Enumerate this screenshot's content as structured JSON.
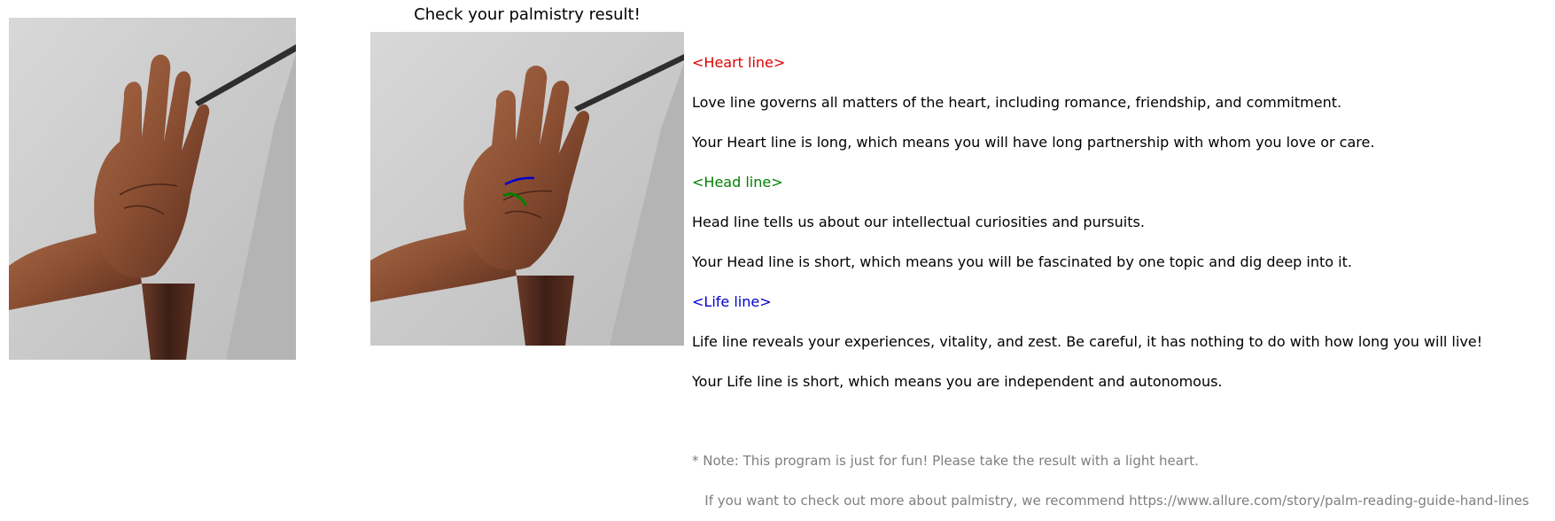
{
  "title": "Check your palmistry result!",
  "colors": {
    "heart": "#e00000",
    "head": "#008000",
    "life": "#0000d0",
    "note": "#7f7f7f",
    "text": "#000000"
  },
  "images": {
    "left": "original-hand-photo",
    "right": "annotated-hand-photo"
  },
  "sections": [
    {
      "heading": "<Heart line>",
      "lines": [
        "Love line governs all matters of the heart, including romance, friendship, and commitment.",
        "Your Heart line is long, which means you will have long partnership with whom you love or care."
      ]
    },
    {
      "heading": "<Head line>",
      "lines": [
        "Head line tells us about our intellectual curiosities and pursuits.",
        "Your Head line is short, which means you will be fascinated by one topic and dig deep into it."
      ]
    },
    {
      "heading": "<Life line>",
      "lines": [
        "Life line reveals your experiences, vitality, and zest. Be careful, it has nothing to do with how long you will live!",
        "Your Life line is short, which means you are independent and autonomous."
      ]
    }
  ],
  "note": {
    "line1": "* Note: This program is just for fun! Please take the result with a light heart.",
    "line2": "   If you want to check out more about palmistry, we recommend https://www.allure.com/story/palm-reading-guide-hand-lines"
  }
}
